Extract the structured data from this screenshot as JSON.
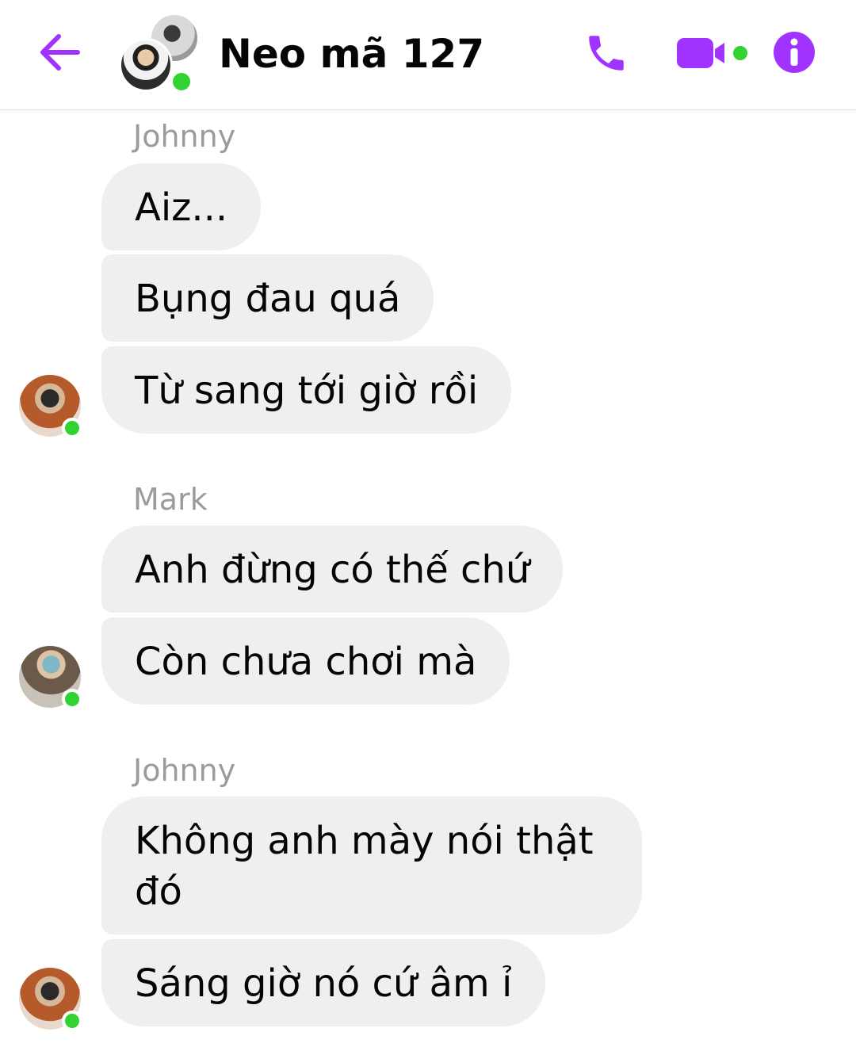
{
  "header": {
    "title": "Neo mã 127",
    "back_icon": "back-arrow-icon",
    "call_icon": "phone-icon",
    "video_icon": "video-camera-icon",
    "info_icon": "info-icon",
    "accent_color": "#a033ff",
    "online_color": "#31d231"
  },
  "messages": [
    {
      "sender": "Johnny",
      "bubbles": [
        "Aiz...",
        "Bụng đau quá",
        "Từ sang tới giờ rồi"
      ]
    },
    {
      "sender": "Mark",
      "bubbles": [
        "Anh đừng có thế chứ",
        "Còn chưa chơi mà"
      ]
    },
    {
      "sender": "Johnny",
      "bubbles": [
        "Không anh mày nói thật đó",
        "Sáng giờ nó cứ âm ỉ"
      ]
    }
  ]
}
